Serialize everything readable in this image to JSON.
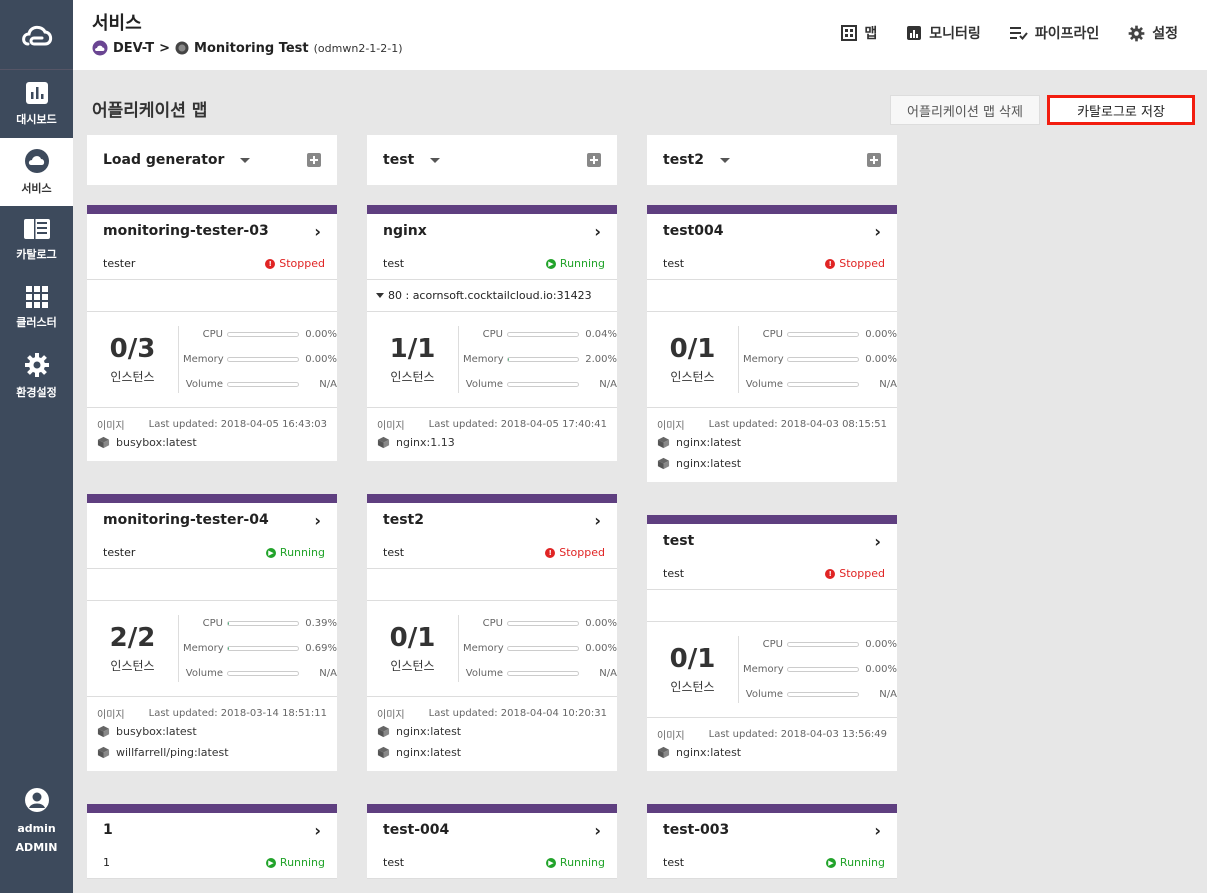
{
  "sidebar": {
    "items": [
      {
        "label": "대시보드",
        "icon": "dashboard-icon"
      },
      {
        "label": "서비스",
        "icon": "cloud-icon",
        "active": true
      },
      {
        "label": "카탈로그",
        "icon": "catalog-icon"
      },
      {
        "label": "클러스터",
        "icon": "grid-icon"
      },
      {
        "label": "환경설정",
        "icon": "gear-icon"
      }
    ],
    "user": {
      "name": "admin",
      "role": "ADMIN",
      "icon": "user-icon"
    }
  },
  "header": {
    "title": "서비스",
    "breadcrumb": {
      "workspace": "DEV-T",
      "separator": ">",
      "service": "Monitoring Test",
      "service_id": "(odmwn2-1-2-1)"
    },
    "nav": [
      {
        "label": "맵",
        "icon": "map-icon"
      },
      {
        "label": "모니터링",
        "icon": "chart-icon"
      },
      {
        "label": "파이프라인",
        "icon": "pipeline-icon"
      },
      {
        "label": "설정",
        "icon": "gear-icon"
      }
    ]
  },
  "main": {
    "section_title": "어플리케이션 맵",
    "delete_button": "어플리케이션 맵 삭제",
    "catalog_button": "카탈로그로 저장",
    "labels": {
      "instances": "인스턴스",
      "cpu": "CPU",
      "memory": "Memory",
      "volume": "Volume",
      "images": "이미지"
    },
    "groups": [
      {
        "name": "Load generator",
        "cards": [
          {
            "name": "monitoring-tester-03",
            "namespace": "tester",
            "status": "Stopped",
            "instances": "0/3",
            "cpu": "0.00%",
            "memory": "0.00%",
            "volume": "N/A",
            "cpu_level": 0,
            "memory_level": 0,
            "updated": "Last updated: 2018-04-05 16:43:03",
            "images": [
              "busybox:latest"
            ]
          },
          {
            "name": "monitoring-tester-04",
            "namespace": "tester",
            "status": "Running",
            "instances": "2/2",
            "cpu": "0.39%",
            "memory": "0.69%",
            "volume": "N/A",
            "cpu_level": 0.39,
            "memory_level": 0.69,
            "updated": "Last updated: 2018-03-14 18:51:11",
            "images": [
              "busybox:latest",
              "willfarrell/ping:latest"
            ]
          },
          {
            "name": "1",
            "namespace": "1",
            "status": "Running"
          }
        ]
      },
      {
        "name": "test",
        "cards": [
          {
            "name": "nginx",
            "namespace": "test",
            "status": "Running",
            "port": "80 : acornsoft.cocktailcloud.io:31423",
            "instances": "1/1",
            "cpu": "0.04%",
            "memory": "2.00%",
            "volume": "N/A",
            "cpu_level": 0.04,
            "memory_level": 2.0,
            "updated": "Last updated: 2018-04-05 17:40:41",
            "images": [
              "nginx:1.13"
            ]
          },
          {
            "name": "test2",
            "namespace": "test",
            "status": "Stopped",
            "instances": "0/1",
            "cpu": "0.00%",
            "memory": "0.00%",
            "volume": "N/A",
            "cpu_level": 0,
            "memory_level": 0,
            "updated": "Last updated: 2018-04-04 10:20:31",
            "images": [
              "nginx:latest",
              "nginx:latest"
            ]
          },
          {
            "name": "test-004",
            "namespace": "test",
            "status": "Running"
          }
        ]
      },
      {
        "name": "test2",
        "cards": [
          {
            "name": "test004",
            "namespace": "test",
            "status": "Stopped",
            "instances": "0/1",
            "cpu": "0.00%",
            "memory": "0.00%",
            "volume": "N/A",
            "cpu_level": 0,
            "memory_level": 0,
            "updated": "Last updated: 2018-04-03 08:15:51",
            "images": [
              "nginx:latest",
              "nginx:latest"
            ]
          },
          {
            "name": "test",
            "namespace": "test",
            "status": "Stopped",
            "instances": "0/1",
            "cpu": "0.00%",
            "memory": "0.00%",
            "volume": "N/A",
            "cpu_level": 0,
            "memory_level": 0,
            "updated": "Last updated: 2018-04-03 13:56:49",
            "images": [
              "nginx:latest"
            ]
          },
          {
            "name": "test-003",
            "namespace": "test",
            "status": "Running"
          }
        ]
      }
    ]
  }
}
